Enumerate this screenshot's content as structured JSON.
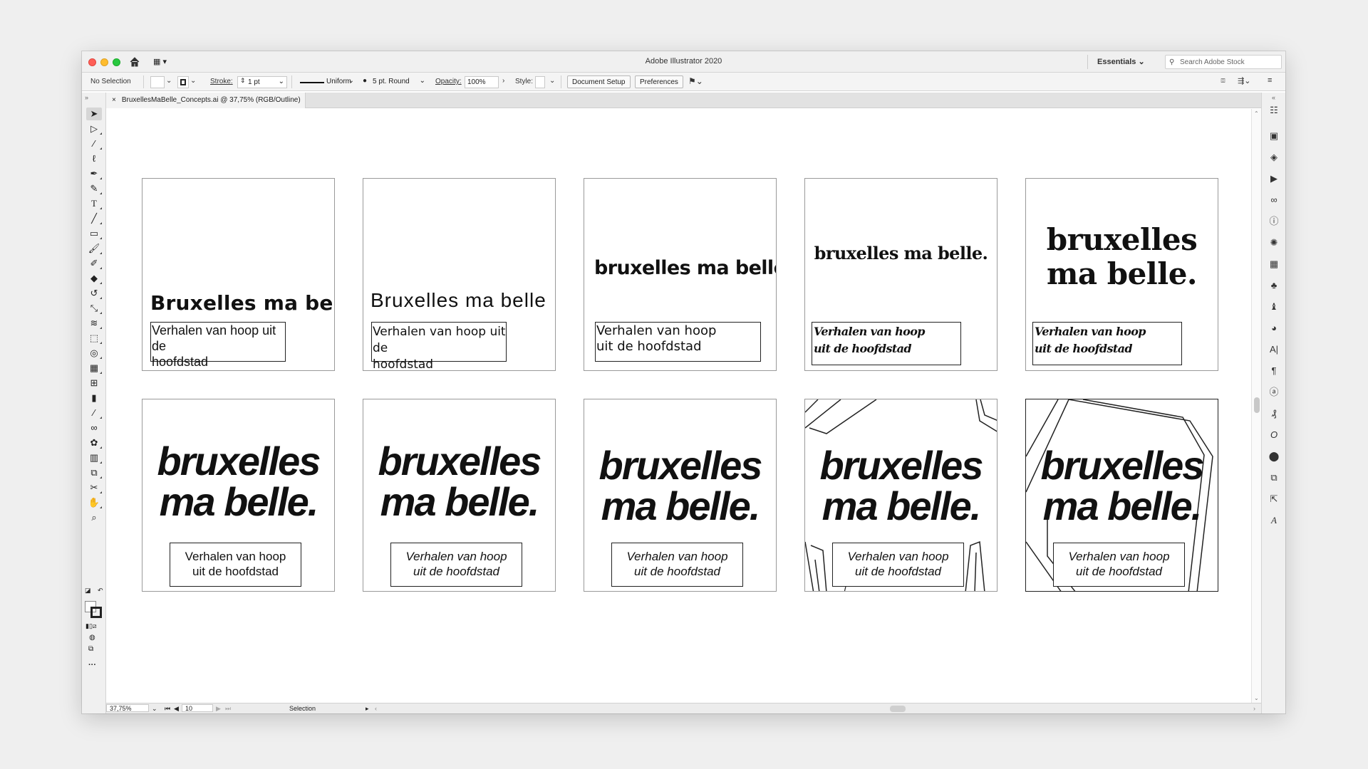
{
  "app": {
    "title": "Adobe Illustrator 2020",
    "workspace": "Essentials",
    "search_placeholder": "Search Adobe Stock"
  },
  "control_bar": {
    "selection": "No Selection",
    "stroke_label": "Stroke:",
    "stroke_value": "1 pt",
    "profile": "Uniform",
    "brush": "5 pt. Round",
    "opacity_label": "Opacity:",
    "opacity_value": "100%",
    "style_label": "Style:",
    "document_setup": "Document Setup",
    "preferences": "Preferences"
  },
  "document_tab": {
    "close": "×",
    "title": "BruxellesMaBelle_Concepts.ai @ 37,75% (RGB/Outline)"
  },
  "status_bar": {
    "zoom": "37,75%",
    "artboard": "10",
    "tool": "Selection"
  },
  "artboards": [
    {
      "head": "Bruxelles ma belle",
      "sub": [
        "Verhalen van hoop uit de",
        "hoofdstad"
      ]
    },
    {
      "head": "Bruxelles ma belle",
      "sub": [
        "Verhalen van hoop uit de",
        "hoofdstad"
      ]
    },
    {
      "head": "bruxelles ma belle.",
      "sub": [
        "Verhalen van hoop",
        "uit de hoofdstad"
      ]
    },
    {
      "head": "bruxelles ma belle.",
      "sub": [
        "Verhalen van hoop",
        "uit de hoofdstad"
      ]
    },
    {
      "head": [
        "bruxelles",
        "ma belle."
      ],
      "sub": [
        "Verhalen van hoop",
        "uit de hoofdstad"
      ]
    },
    {
      "head": [
        "bruxelles",
        "ma belle."
      ],
      "sub": [
        "Verhalen van hoop",
        "uit de hoofdstad"
      ]
    },
    {
      "head": [
        "bruxelles",
        "ma belle."
      ],
      "sub": [
        "Verhalen van hoop",
        "uit de hoofdstad"
      ]
    },
    {
      "head": [
        "bruxelles",
        "ma belle."
      ],
      "sub": [
        "Verhalen van hoop",
        "uit de hoofdstad"
      ]
    },
    {
      "head": [
        "bruxelles",
        "ma belle."
      ],
      "sub": [
        "Verhalen van hoop",
        "uit de hoofdstad"
      ]
    },
    {
      "head": [
        "bruxelles",
        "ma belle."
      ],
      "sub": [
        "Verhalen van hoop",
        "uit de hoofdstad"
      ]
    }
  ],
  "tools": [
    "selection-tool",
    "direct-selection-tool",
    "magic-wand-tool",
    "lasso-tool",
    "pen-tool",
    "curvature-tool",
    "type-tool",
    "line-segment-tool",
    "rectangle-tool",
    "paintbrush-tool",
    "shaper-tool",
    "eraser-tool",
    "rotate-tool",
    "scale-tool",
    "warp-tool",
    "free-transform-tool",
    "shape-builder-tool",
    "perspective-grid-tool",
    "mesh-tool",
    "gradient-tool",
    "eyedropper-tool",
    "blend-tool",
    "symbol-sprayer-tool",
    "column-graph-tool",
    "artboard-tool",
    "slice-tool",
    "hand-tool",
    "zoom-tool"
  ],
  "panels": [
    "properties-icon",
    "libraries-icon",
    "layers-icon",
    "actions-icon",
    "links-icon",
    "info-icon",
    "appearance-icon",
    "swatches-icon",
    "symbols-icon",
    "brushes-icon",
    "graphic-styles-icon",
    "character-icon",
    "paragraph-icon",
    "character-styles-icon",
    "paragraph-styles-icon",
    "opentype-icon",
    "color-icon",
    "pathfinder-icon",
    "export-icon",
    "glyphs-icon"
  ]
}
